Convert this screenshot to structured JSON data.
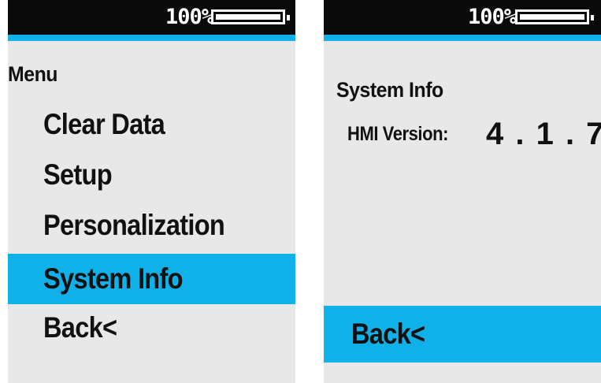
{
  "status_bar": {
    "battery_percent_text": "100%",
    "battery_level": 1.0
  },
  "colors": {
    "accent": "#10b0e8",
    "status_bar_bg": "#0a0a0a",
    "screen_bg": "#e8e8e8",
    "text": "#111111"
  },
  "menu_screen": {
    "title": "Menu",
    "items": [
      {
        "label": "Clear Data"
      },
      {
        "label": "Setup"
      },
      {
        "label": "Personalization"
      },
      {
        "label": "System Info",
        "selected": true
      },
      {
        "label": "Back<"
      }
    ]
  },
  "system_info_screen": {
    "title": "System Info",
    "hmi_version_label": "HMI Version:",
    "hmi_version_value": "4 . 1 . 7",
    "back_label": "Back<"
  },
  "icons": [
    "battery-icon"
  ]
}
